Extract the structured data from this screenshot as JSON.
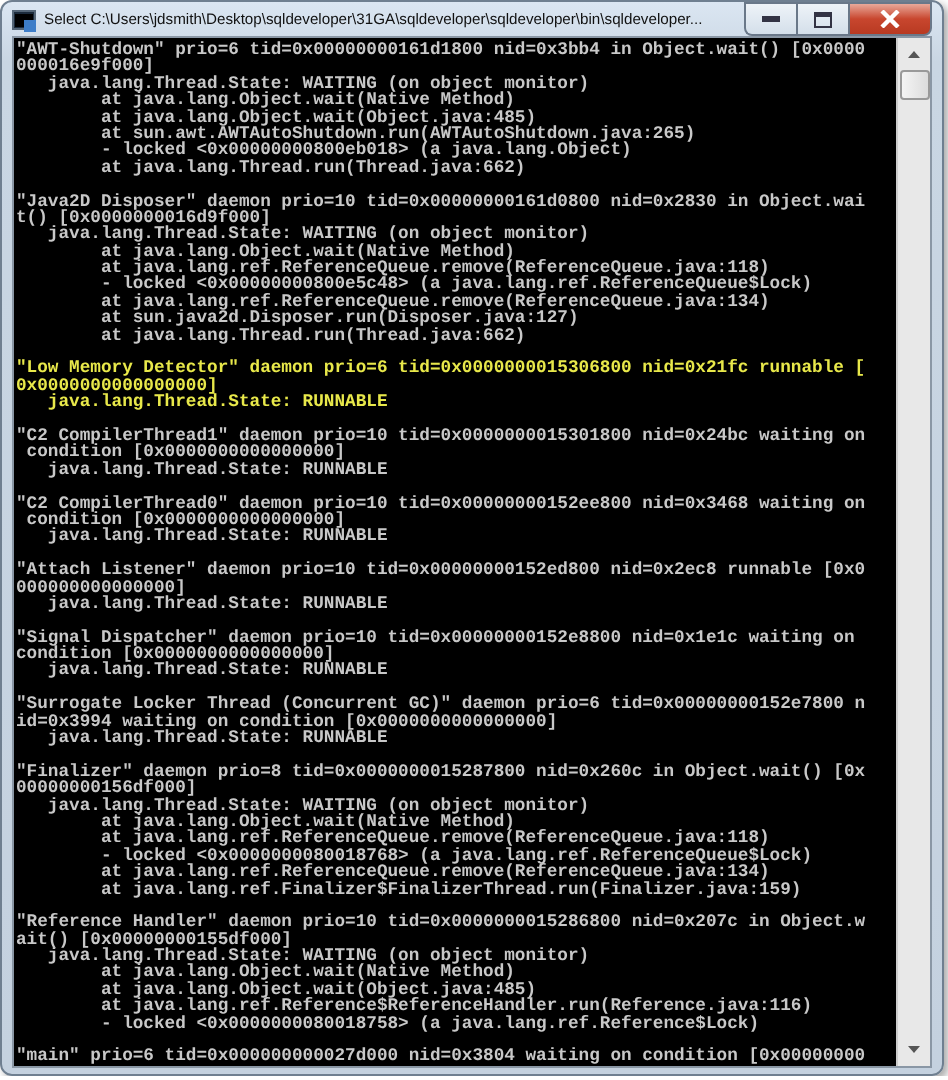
{
  "window": {
    "title": "Select C:\\Users\\jdsmith\\Desktop\\sqldeveloper\\31GA\\sqldeveloper\\sqldeveloper\\bin\\sqldeveloper..."
  },
  "console": {
    "blocks": [
      {
        "highlighted": false,
        "lines": [
          "\"AWT-Shutdown\" prio=6 tid=0x00000000161d1800 nid=0x3bb4 in Object.wait() [0x0000",
          "000016e9f000]",
          "   java.lang.Thread.State: WAITING (on object monitor)",
          "        at java.lang.Object.wait(Native Method)",
          "        at java.lang.Object.wait(Object.java:485)",
          "        at sun.awt.AWTAutoShutdown.run(AWTAutoShutdown.java:265)",
          "        - locked <0x00000000800eb018> (a java.lang.Object)",
          "        at java.lang.Thread.run(Thread.java:662)"
        ]
      },
      {
        "highlighted": false,
        "lines": [
          "\"Java2D Disposer\" daemon prio=10 tid=0x00000000161d0800 nid=0x2830 in Object.wai",
          "t() [0x0000000016d9f000]",
          "   java.lang.Thread.State: WAITING (on object monitor)",
          "        at java.lang.Object.wait(Native Method)",
          "        at java.lang.ref.ReferenceQueue.remove(ReferenceQueue.java:118)",
          "        - locked <0x00000000800e5c48> (a java.lang.ref.ReferenceQueue$Lock)",
          "        at java.lang.ref.ReferenceQueue.remove(ReferenceQueue.java:134)",
          "        at sun.java2d.Disposer.run(Disposer.java:127)",
          "        at java.lang.Thread.run(Thread.java:662)"
        ]
      },
      {
        "highlighted": true,
        "lines": [
          "\"Low Memory Detector\" daemon prio=6 tid=0x0000000015306800 nid=0x21fc runnable [",
          "0x0000000000000000]",
          "   java.lang.Thread.State: RUNNABLE"
        ]
      },
      {
        "highlighted": false,
        "lines": [
          "\"C2 CompilerThread1\" daemon prio=10 tid=0x0000000015301800 nid=0x24bc waiting on",
          " condition [0x0000000000000000]",
          "   java.lang.Thread.State: RUNNABLE"
        ]
      },
      {
        "highlighted": false,
        "lines": [
          "\"C2 CompilerThread0\" daemon prio=10 tid=0x00000000152ee800 nid=0x3468 waiting on",
          " condition [0x0000000000000000]",
          "   java.lang.Thread.State: RUNNABLE"
        ]
      },
      {
        "highlighted": false,
        "lines": [
          "\"Attach Listener\" daemon prio=10 tid=0x00000000152ed800 nid=0x2ec8 runnable [0x0",
          "000000000000000]",
          "   java.lang.Thread.State: RUNNABLE"
        ]
      },
      {
        "highlighted": false,
        "lines": [
          "\"Signal Dispatcher\" daemon prio=10 tid=0x00000000152e8800 nid=0x1e1c waiting on",
          "condition [0x0000000000000000]",
          "   java.lang.Thread.State: RUNNABLE"
        ]
      },
      {
        "highlighted": false,
        "lines": [
          "\"Surrogate Locker Thread (Concurrent GC)\" daemon prio=6 tid=0x00000000152e7800 n",
          "id=0x3994 waiting on condition [0x0000000000000000]",
          "   java.lang.Thread.State: RUNNABLE"
        ]
      },
      {
        "highlighted": false,
        "lines": [
          "\"Finalizer\" daemon prio=8 tid=0x0000000015287800 nid=0x260c in Object.wait() [0x",
          "00000000156df000]",
          "   java.lang.Thread.State: WAITING (on object monitor)",
          "        at java.lang.Object.wait(Native Method)",
          "        at java.lang.ref.ReferenceQueue.remove(ReferenceQueue.java:118)",
          "        - locked <0x0000000080018768> (a java.lang.ref.ReferenceQueue$Lock)",
          "        at java.lang.ref.ReferenceQueue.remove(ReferenceQueue.java:134)",
          "        at java.lang.ref.Finalizer$FinalizerThread.run(Finalizer.java:159)"
        ]
      },
      {
        "highlighted": false,
        "lines": [
          "\"Reference Handler\" daemon prio=10 tid=0x0000000015286800 nid=0x207c in Object.w",
          "ait() [0x00000000155df000]",
          "   java.lang.Thread.State: WAITING (on object monitor)",
          "        at java.lang.Object.wait(Native Method)",
          "        at java.lang.Object.wait(Object.java:485)",
          "        at java.lang.ref.Reference$ReferenceHandler.run(Reference.java:116)",
          "        - locked <0x0000000080018758> (a java.lang.ref.Reference$Lock)"
        ]
      },
      {
        "highlighted": false,
        "lines": [
          "\"main\" prio=6 tid=0x000000000027d000 nid=0x3804 waiting on condition [0x00000000"
        ]
      }
    ]
  }
}
